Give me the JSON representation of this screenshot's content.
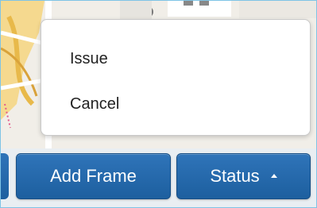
{
  "dropdown_menu": {
    "items": [
      {
        "label": "Issue"
      },
      {
        "label": "Cancel"
      }
    ]
  },
  "toolbar": {
    "add_frame_label": "Add Frame",
    "status_label": "Status",
    "status_caret_icon": "caret-up-icon"
  },
  "colors": {
    "button_primary": "#2567ab",
    "border_accent": "#7fc4e6"
  }
}
